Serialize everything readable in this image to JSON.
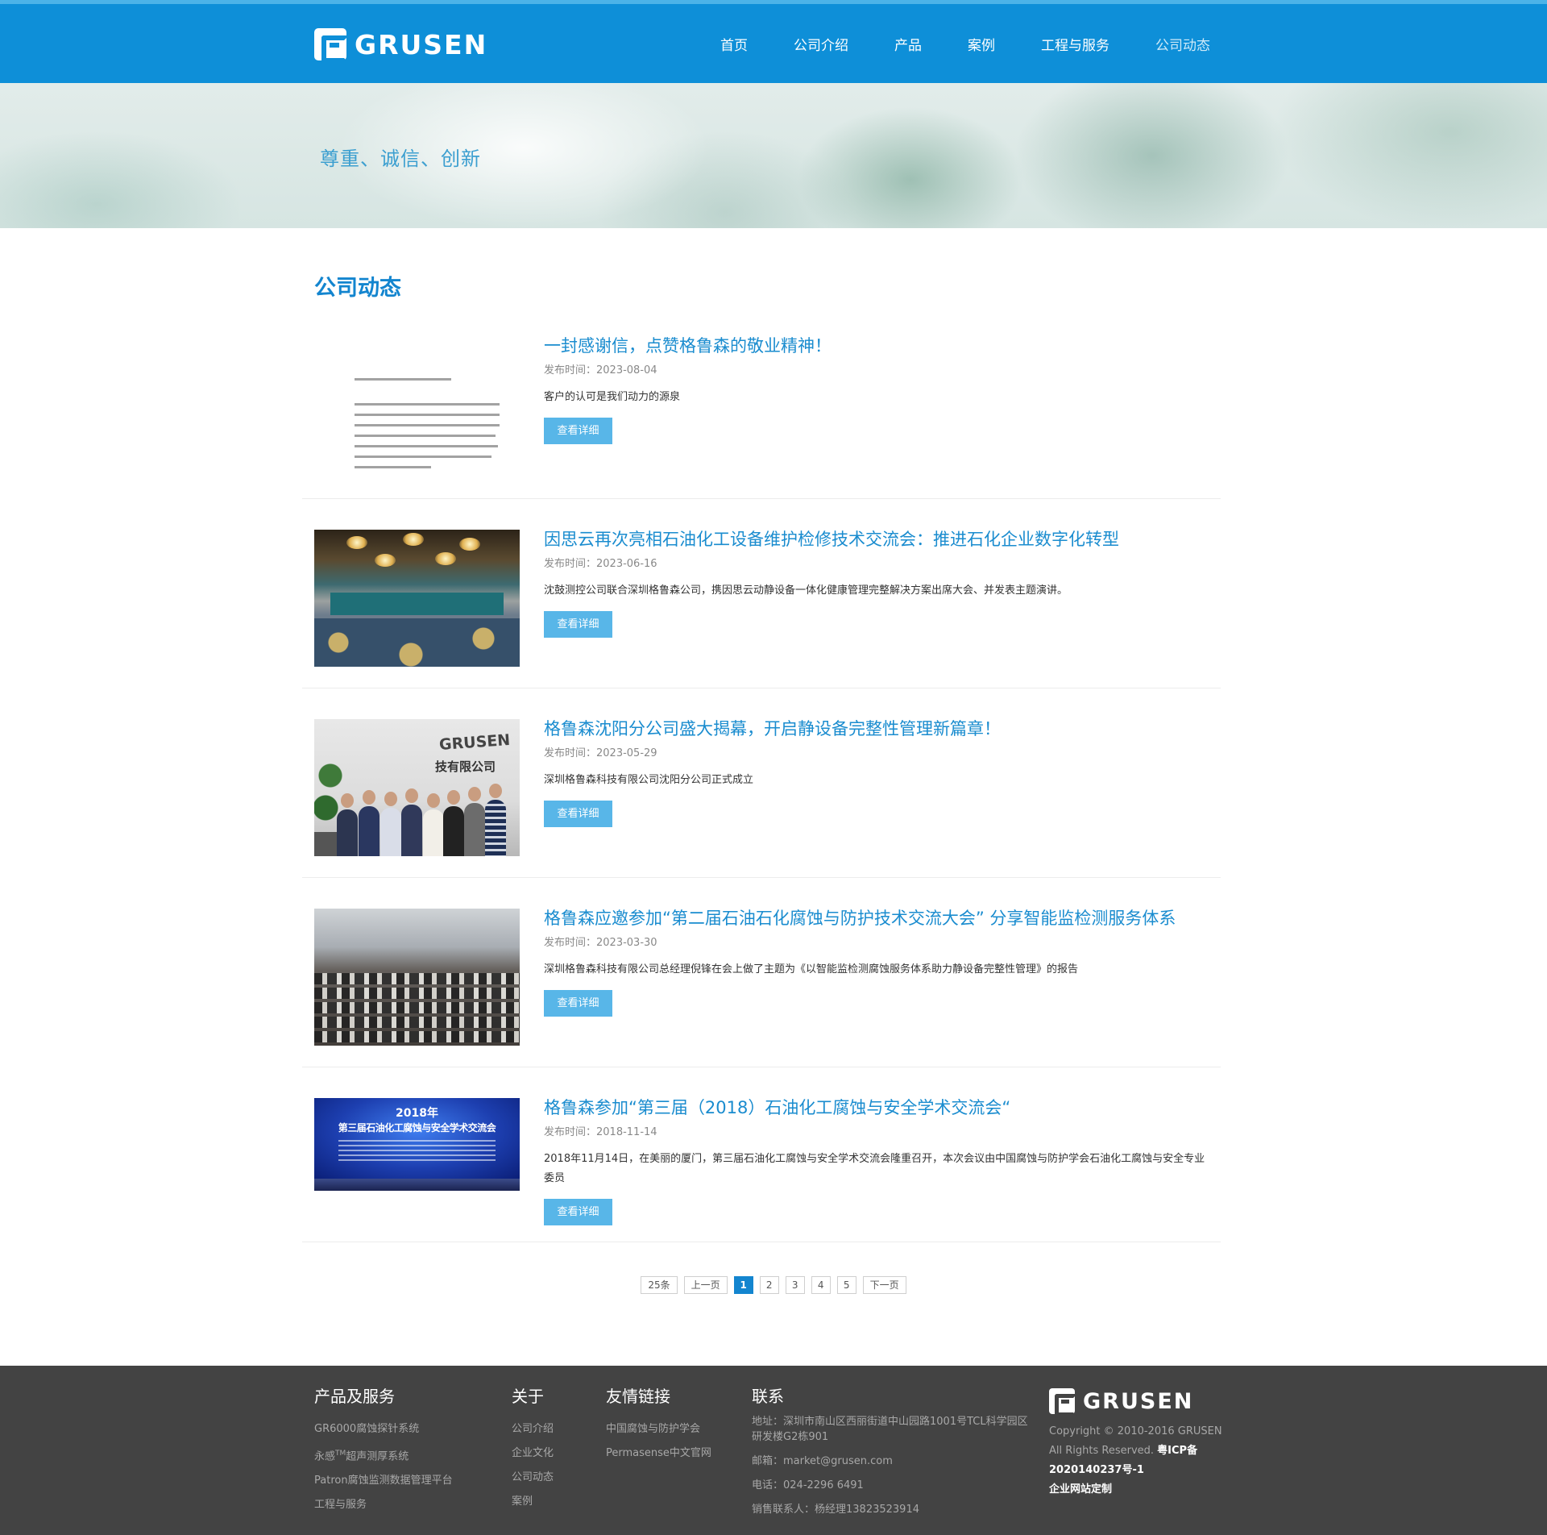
{
  "header": {
    "logo_text": "GRUSEN",
    "nav": [
      "首页",
      "公司介绍",
      "产品",
      "案例",
      "工程与服务",
      "公司动态"
    ]
  },
  "banner": {
    "slogan": "尊重、诚信、创新"
  },
  "page_heading": "公司动态",
  "news": [
    {
      "title": "一封感谢信，点赞格鲁森的敬业精神！",
      "date": "发布时间：2023-08-04",
      "desc": "客户的认可是我们动力的源泉",
      "button": "查看详细"
    },
    {
      "title": "因思云再次亮相石油化工设备维护检修技术交流会：推进石化企业数字化转型",
      "date": "发布时间：2023-06-16",
      "desc": "沈鼓测控公司联合深圳格鲁森公司，携因思云动静设备一体化健康管理完整解决方案出席大会、并发表主题演讲。",
      "button": "查看详细"
    },
    {
      "title": "格鲁森沈阳分公司盛大揭幕，开启静设备完整性管理新篇章！",
      "date": "发布时间：2023-05-29",
      "desc": "深圳格鲁森科技有限公司沈阳分公司正式成立",
      "button": "查看详细"
    },
    {
      "title": "格鲁森应邀参加“第二届石油石化腐蚀与防护技术交流大会” 分享智能监检测服务体系",
      "date": "发布时间：2023-03-30",
      "desc": "深圳格鲁森科技有限公司总经理倪锋在会上做了主题为《以智能监检测腐蚀服务体系助力静设备完整性管理》的报告",
      "button": "查看详细"
    },
    {
      "title": "格鲁森参加“第三届（2018）石油化工腐蚀与安全学术交流会“",
      "date": "发布时间：2018-11-14",
      "desc": "2018年11月14日，在美丽的厦门，第三届石油化工腐蚀与安全学术交流会隆重召开，本次会议由中国腐蚀与防护学会石油化工腐蚀与安全专业委员",
      "button": "查看详细"
    }
  ],
  "thumbs": {
    "group_wall_logo": "GRUSEN",
    "group_wall_text": "技有限公司",
    "stage_year": "2018年",
    "stage_title": "第三届石油化工腐蚀与安全学术交流会"
  },
  "pagination": {
    "total": "25条",
    "prev": "上一页",
    "pages": [
      "1",
      "2",
      "3",
      "4",
      "5"
    ],
    "current": "1",
    "next": "下一页"
  },
  "footer": {
    "col1": {
      "title": "产品及服务",
      "links": [
        "GR6000腐蚀探针系统",
        "永感",
        "超声测厚系统",
        "Patron腐蚀监测数据管理平台",
        "工程与服务"
      ],
      "tm": "TM"
    },
    "col2": {
      "title": "关于",
      "links": [
        "公司介绍",
        "企业文化",
        "公司动态",
        "案例"
      ]
    },
    "col3": {
      "title": "友情链接",
      "links": [
        "中国腐蚀与防护学会",
        "Permasense中文官网"
      ]
    },
    "col4": {
      "title": "联系",
      "address": "地址：深圳市南山区西丽街道中山园路1001号TCL科学园区研发楼G2栋901",
      "email": "邮箱：market@grusen.com",
      "phone": "电话：024-2296 6491",
      "sales": "销售联系人：杨经理13823523914"
    },
    "logo_text": "GRUSEN",
    "copyright_1": "Copyright © 2010-2016 GRUSEN",
    "copyright_2": "All Rights Reserved.",
    "icp_1": "粤ICP备",
    "icp_2": "2020140237号-1",
    "custom": "企业网站定制"
  }
}
